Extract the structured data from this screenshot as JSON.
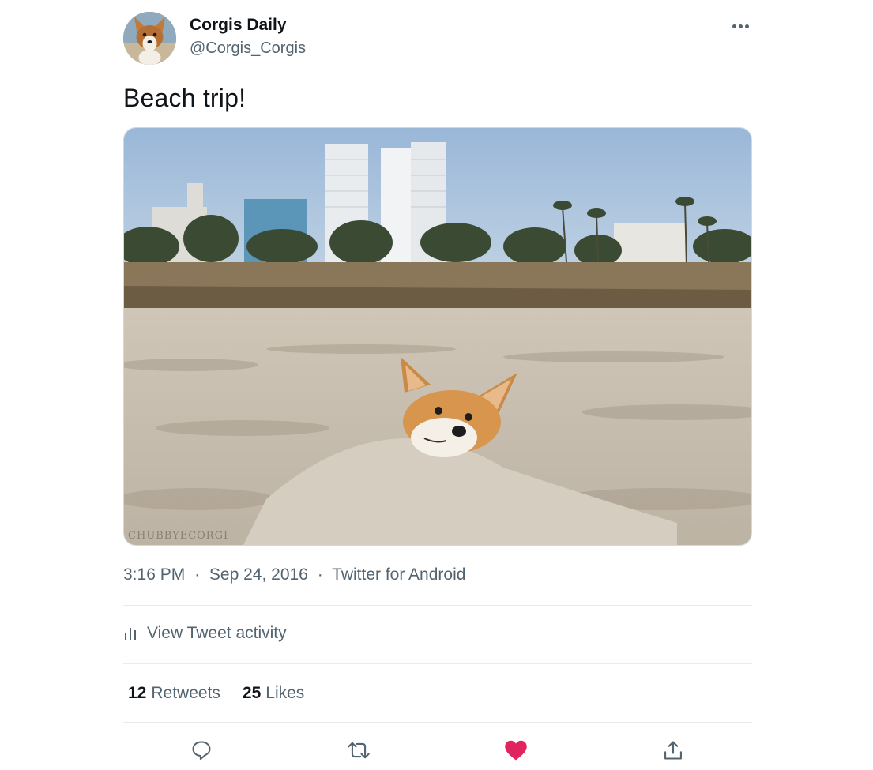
{
  "author": {
    "display_name": "Corgis Daily",
    "handle": "@Corgis_Corgis",
    "avatar": "corgi-puppy-avatar"
  },
  "tweet": {
    "text": "Beach trip!",
    "media": {
      "description_icon": "corgi-on-beach-photo",
      "watermark": "CHUBBYECORGI"
    },
    "time": "3:16 PM",
    "date": "Sep 24, 2016",
    "source": "Twitter for Android",
    "separator": "·"
  },
  "activity": {
    "label": "View Tweet activity",
    "icon": "bar-chart-icon"
  },
  "stats": {
    "retweets_count": "12",
    "retweets_label": "Retweets",
    "likes_count": "25",
    "likes_label": "Likes"
  },
  "actions": {
    "reply_icon": "reply-icon",
    "retweet_icon": "retweet-icon",
    "like_icon": "heart-icon",
    "share_icon": "share-icon",
    "like_color": "#e0245e",
    "icon_color": "#536471"
  },
  "more_icon": "more-dots-icon"
}
